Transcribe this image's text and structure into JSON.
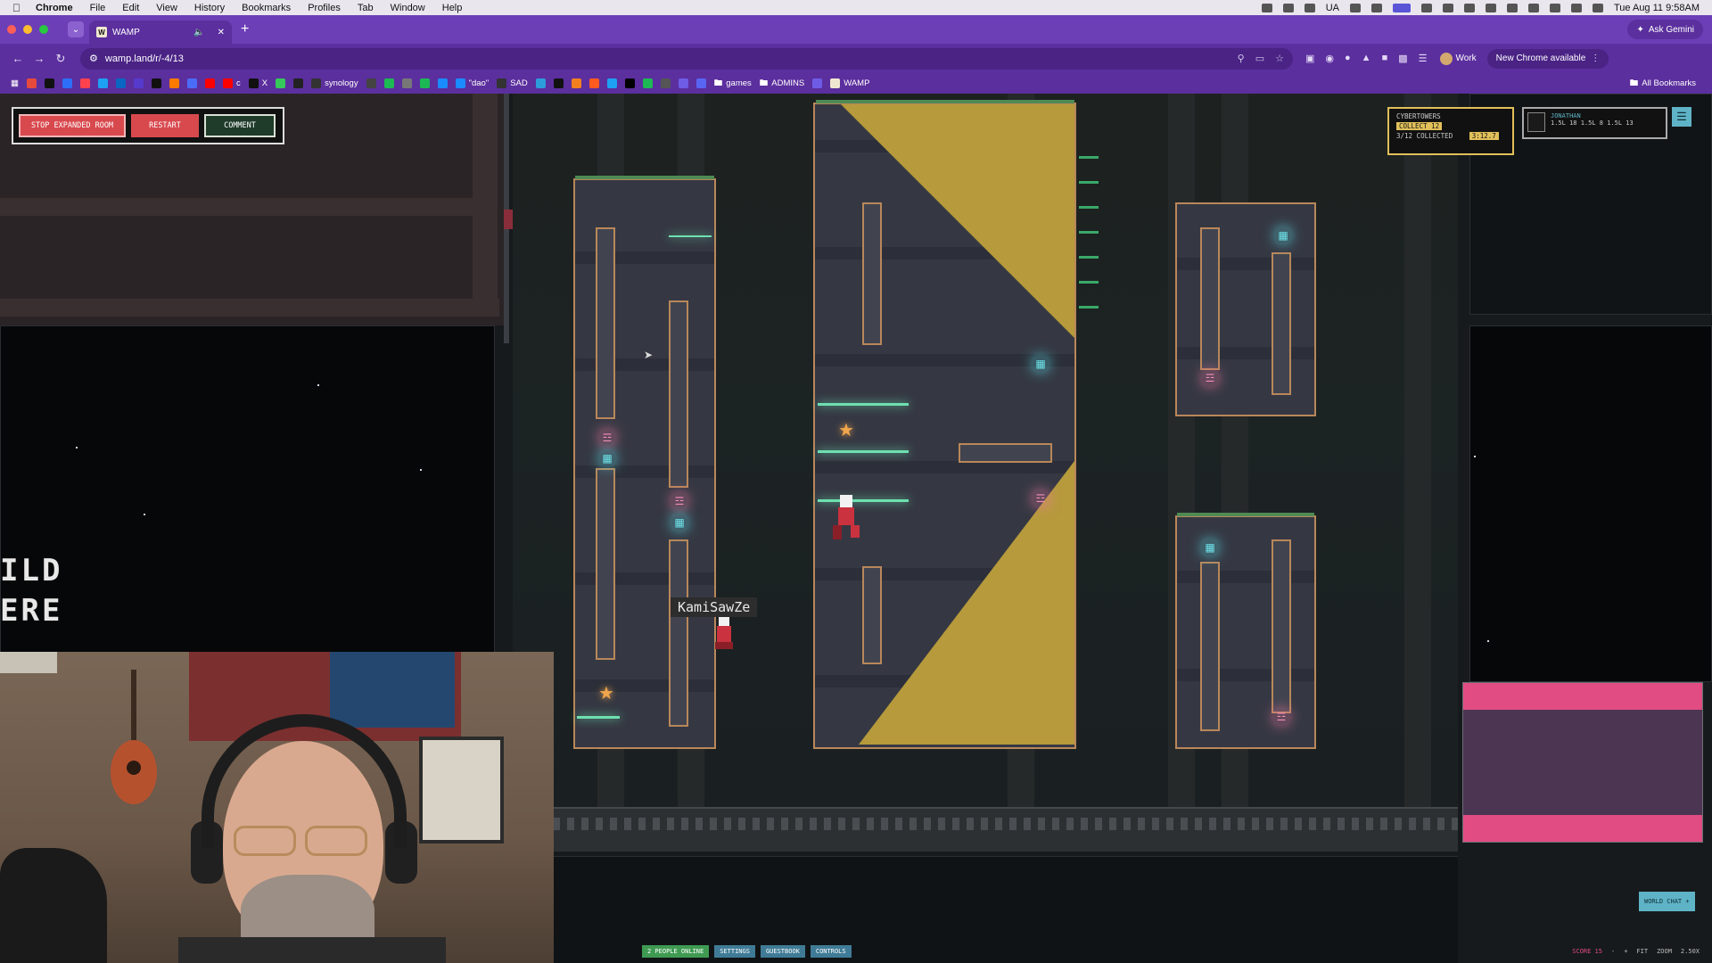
{
  "menubar": {
    "app": "Chrome",
    "items": [
      "File",
      "Edit",
      "View",
      "History",
      "Bookmarks",
      "Profiles",
      "Tab",
      "Window",
      "Help"
    ],
    "status_ua": "UA",
    "datetime": "Tue Aug 11  9:58AM"
  },
  "browser": {
    "tab_title": "WAMP",
    "tab_favicon": "W",
    "ask_gemini": "Ask Gemini",
    "url": "wamp.land/r/-4/13",
    "profile": "Work",
    "new_chrome": "New Chrome available",
    "bookmarks": [
      {
        "label": "",
        "color": "#e64a3c"
      },
      {
        "label": "",
        "color": "#111111"
      },
      {
        "label": "",
        "color": "#2d6ff7"
      },
      {
        "label": "",
        "color": "#ff424d"
      },
      {
        "label": "",
        "color": "#1da1f2"
      },
      {
        "label": "",
        "color": "#0a66c2"
      },
      {
        "label": "",
        "color": "#563acc"
      },
      {
        "label": "",
        "color": "#111111"
      },
      {
        "label": "",
        "color": "#ff7a00"
      },
      {
        "label": "",
        "color": "#4b6cf7"
      },
      {
        "label": "",
        "color": "#ff0000"
      },
      {
        "label": "c",
        "color": "#ff0000"
      },
      {
        "label": "X",
        "color": "#111111"
      },
      {
        "label": "",
        "color": "#35c759"
      },
      {
        "label": "",
        "color": "#222222"
      },
      {
        "label": "synology",
        "color": "#333333"
      },
      {
        "label": "",
        "color": "#444444"
      },
      {
        "label": "",
        "color": "#1db954"
      },
      {
        "label": "",
        "color": "#777777"
      },
      {
        "label": "",
        "color": "#1db954"
      },
      {
        "label": "",
        "color": "#1a8cff"
      },
      {
        "label": "\"dao\"",
        "color": "#1a8cff"
      },
      {
        "label": "SAD",
        "color": "#333333"
      },
      {
        "label": "",
        "color": "#2d9cdb"
      },
      {
        "label": "",
        "color": "#111111"
      },
      {
        "label": "",
        "color": "#f38020"
      },
      {
        "label": "",
        "color": "#ff5a1f"
      },
      {
        "label": "",
        "color": "#1da1f2"
      },
      {
        "label": "",
        "color": "#000000"
      },
      {
        "label": "",
        "color": "#1db954"
      },
      {
        "label": "",
        "color": "#555555"
      },
      {
        "label": "",
        "color": "#6e5ce6"
      },
      {
        "label": "",
        "color": "#5865f2"
      }
    ],
    "folders": [
      "games",
      "ADMINS"
    ],
    "wamp_bookmark": "WAMP",
    "all_bookmarks": "All Bookmarks"
  },
  "game": {
    "buttons": {
      "stop_expanded": "STOP EXPANDED ROOM",
      "restart": "RESTART",
      "comment": "COMMENT"
    },
    "objective": {
      "title": "CYBERTOWERS",
      "collect": "COLLECT 12",
      "collected": "3/12 COLLECTED",
      "timer": "3:12.7"
    },
    "player_panel": {
      "name": "JONATHAN",
      "stats": "1.5L 18  1.5L 8  1.5L 13"
    },
    "player_tag": "KamiSawZe",
    "sign_text_line1": "ILD",
    "sign_text_line2": "ERE",
    "bottom_tabs": [
      "2 PEOPLE ONLINE",
      "SETTINGS",
      "GUESTBOOK",
      "CONTROLS"
    ],
    "world_chat": "WORLD CHAT +",
    "status": {
      "score": "SCORE 15",
      "minus": "-",
      "plus": "+",
      "fit": "FIT",
      "zoom": "ZOOM",
      "zoom_value": "2.50X"
    }
  }
}
